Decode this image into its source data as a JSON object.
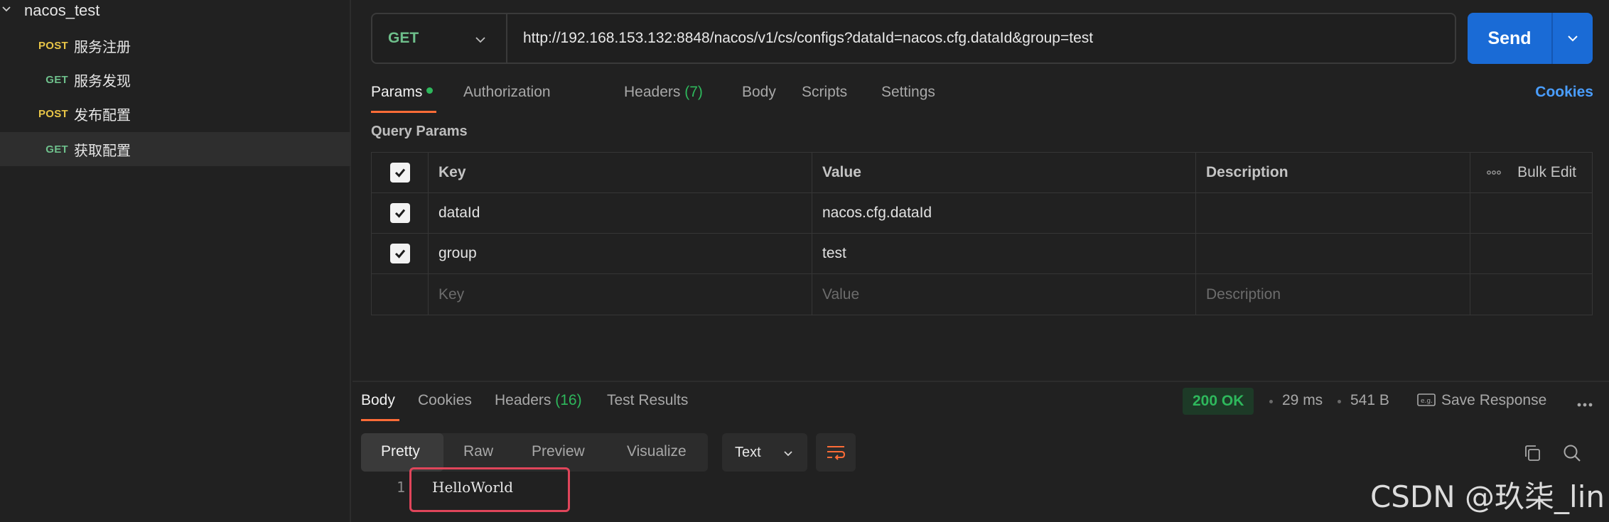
{
  "sidebar": {
    "collection": "nacos_test",
    "requests": [
      {
        "method": "POST",
        "name": "服务注册"
      },
      {
        "method": "GET",
        "name": "服务发现"
      },
      {
        "method": "POST",
        "name": "发布配置"
      },
      {
        "method": "GET",
        "name": "获取配置"
      }
    ]
  },
  "request": {
    "method": "GET",
    "url": "http://192.168.153.132:8848/nacos/v1/cs/configs?dataId=nacos.cfg.dataId&group=test",
    "send_label": "Send"
  },
  "tabs": {
    "params": "Params",
    "authorization": "Authorization",
    "headers": "Headers",
    "headers_count": "(7)",
    "body": "Body",
    "scripts": "Scripts",
    "settings": "Settings",
    "cookies": "Cookies"
  },
  "query_params": {
    "label": "Query Params",
    "headers": {
      "key": "Key",
      "value": "Value",
      "description": "Description",
      "bulk_edit": "Bulk Edit"
    },
    "rows": [
      {
        "key": "dataId",
        "value": "nacos.cfg.dataId",
        "description": ""
      },
      {
        "key": "group",
        "value": "test",
        "description": ""
      }
    ],
    "placeholder": {
      "key": "Key",
      "value": "Value",
      "description": "Description"
    }
  },
  "response": {
    "tabs": {
      "body": "Body",
      "cookies": "Cookies",
      "headers": "Headers",
      "headers_count": "(16)",
      "tests": "Test Results"
    },
    "status": "200 OK",
    "time": "29 ms",
    "size": "541 B",
    "save": "Save Response",
    "views": {
      "pretty": "Pretty",
      "raw": "Raw",
      "preview": "Preview",
      "visualize": "Visualize"
    },
    "format": "Text",
    "line_number": "1",
    "content": "HelloWorld"
  },
  "watermark": "CSDN @玖柒_lin",
  "colors": {
    "accent": "#ff6c37",
    "send": "#1a6bd6",
    "get": "#6ebf8b",
    "post": "#e8c547",
    "ok": "#2eb85c",
    "highlight": "#e0455a"
  }
}
